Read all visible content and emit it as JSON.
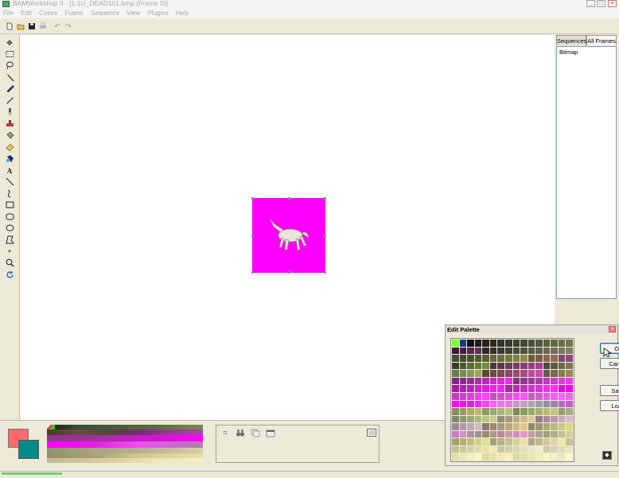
{
  "window": {
    "title": "BAMWorkshop II - [1.1U_DEAD101.bmp (Frame 0)]",
    "buttons": [
      "_",
      "□",
      "×"
    ]
  },
  "menu": [
    "File",
    "Edit",
    "Colors",
    "Frame",
    "Sequence",
    "View",
    "Plugins",
    "Help"
  ],
  "toolbar": {
    "icons": [
      "new-file-icon",
      "open-folder-icon",
      "save-icon",
      "print-icon",
      "undo-icon",
      "redo-icon"
    ]
  },
  "tools": [
    "move-icon",
    "rect-select-icon",
    "lasso-icon",
    "magic-wand-icon",
    "eyedropper-icon",
    "pencil-icon",
    "brush-icon",
    "stamp-icon",
    "bucket-icon",
    "eraser-icon",
    "color-replace-icon",
    "text-icon",
    "line-icon",
    "curve-icon",
    "rectangle-icon",
    "rounded-rect-icon",
    "ellipse-icon",
    "polygon-icon",
    "crosshair-icon",
    "zoom-icon",
    "rotate-icon"
  ],
  "canvas": {
    "frame_color": "#ff00ff"
  },
  "right_panel": {
    "tabs": [
      "Sequences",
      "All Frames"
    ],
    "items": [
      "Bitmap"
    ]
  },
  "colors": {
    "foreground": "#ff6b6b",
    "background": "#008b8b"
  },
  "dialog": {
    "title": "Edit Palette",
    "buttons": {
      "ok": "Ok",
      "cancel": "Cancel",
      "save": "Save",
      "load": "Load"
    }
  }
}
